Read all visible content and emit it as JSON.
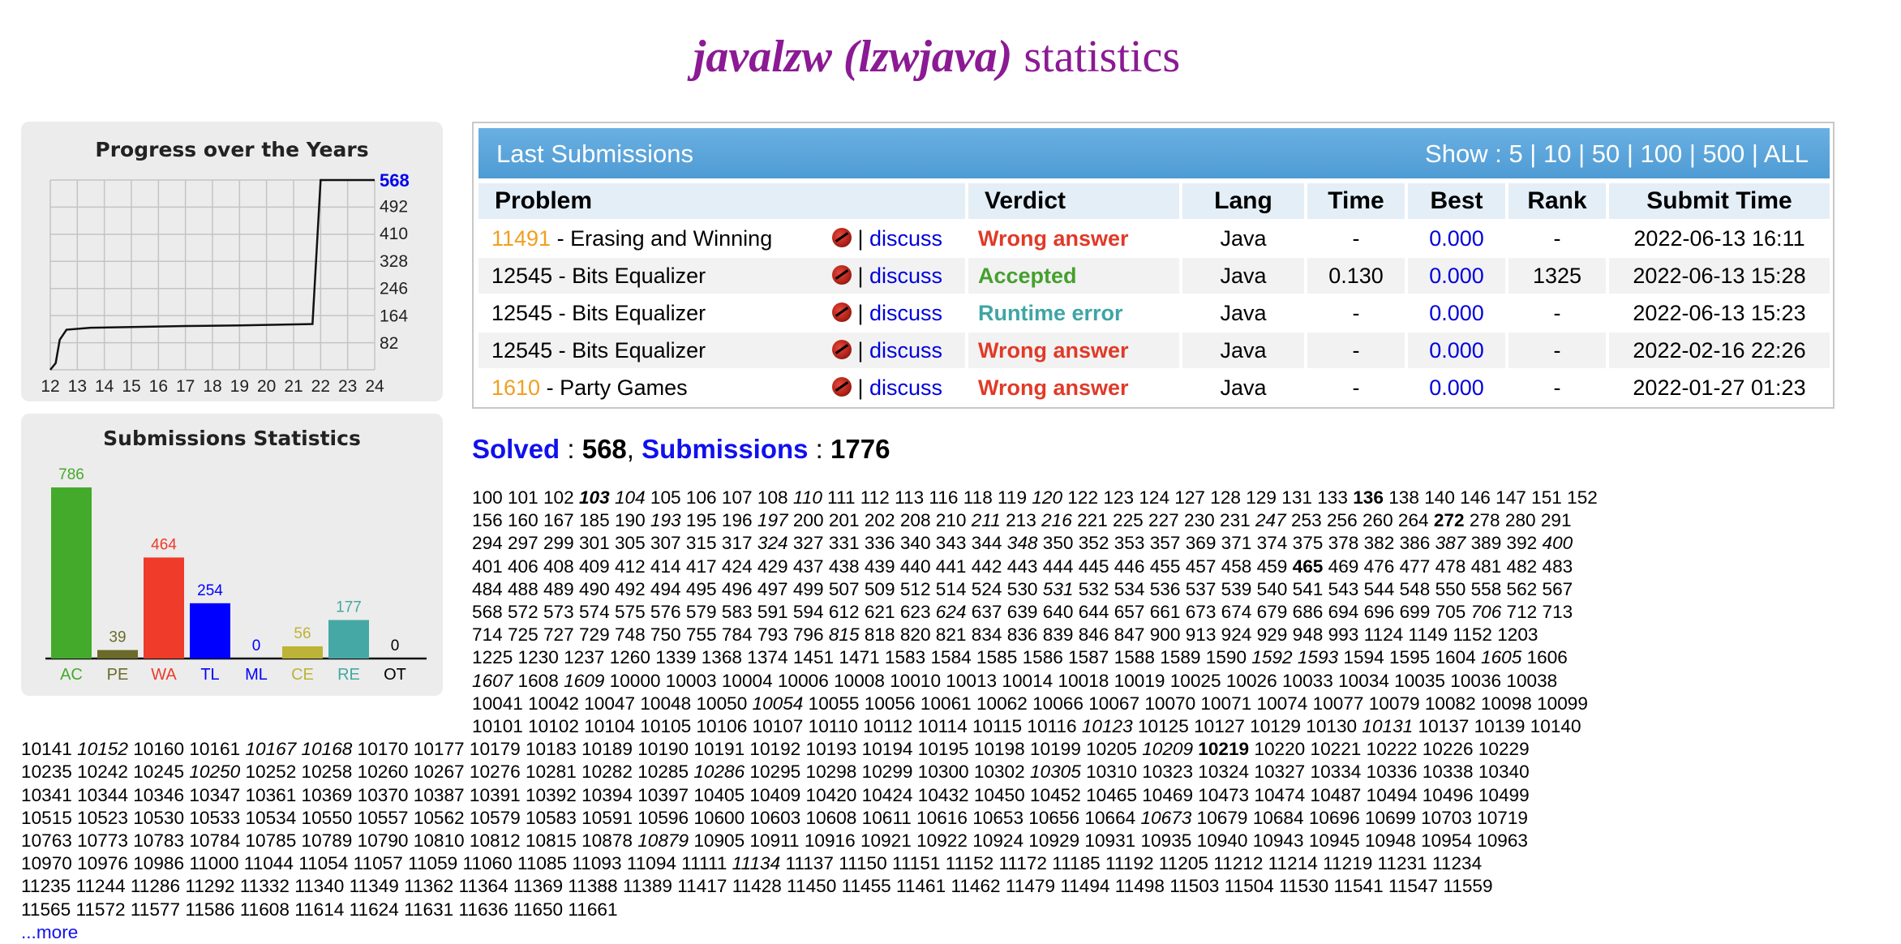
{
  "page": {
    "title_user": "javalzw (lzwjava)",
    "title_suffix": "statistics"
  },
  "progress_chart": {
    "title": "Progress over the Years",
    "x_ticks": [
      "12",
      "13",
      "14",
      "15",
      "16",
      "17",
      "18",
      "19",
      "20",
      "21",
      "22",
      "23",
      "24"
    ],
    "y_ticks": [
      "82",
      "164",
      "246",
      "328",
      "410",
      "492"
    ],
    "current_value_label": "568",
    "current_value_color": "#0000ee"
  },
  "submission_stats": {
    "title": "Submissions Statistics"
  },
  "chart_data": [
    {
      "type": "line",
      "title": "Progress over the Years",
      "x_ticks": [
        "12",
        "13",
        "14",
        "15",
        "16",
        "17",
        "18",
        "19",
        "20",
        "21",
        "22",
        "23",
        "24"
      ],
      "y_ticks": [
        82,
        164,
        246,
        328,
        410,
        492,
        568
      ],
      "ylim": [
        0,
        568
      ],
      "grid": true,
      "series": [
        {
          "points": [
            [
              12.0,
              0
            ],
            [
              12.2,
              20
            ],
            [
              12.35,
              90
            ],
            [
              12.6,
              120
            ],
            [
              13.5,
              126
            ],
            [
              15,
              128
            ],
            [
              17,
              131
            ],
            [
              19,
              133
            ],
            [
              21,
              136
            ],
            [
              21.7,
              137
            ],
            [
              22.0,
              568
            ],
            [
              24.0,
              568
            ]
          ]
        }
      ]
    },
    {
      "type": "bar",
      "title": "Submissions Statistics",
      "categories": [
        "AC",
        "PE",
        "WA",
        "TL",
        "ML",
        "CE",
        "RE",
        "OT"
      ],
      "values": [
        786,
        39,
        464,
        254,
        0,
        56,
        177,
        0
      ],
      "colors": [
        "#44aa2c",
        "#6b6a2a",
        "#ee3b2a",
        "#0000ff",
        "#0000ff",
        "#bdb336",
        "#45a8a4",
        "#000000"
      ],
      "label_colors": [
        "#44aa2c",
        "#6b6a2a",
        "#ee3b2a",
        "#0000ff",
        "#0000ff",
        "#bdb336",
        "#45a8a4",
        "#000000"
      ],
      "ylim": [
        0,
        786
      ]
    }
  ],
  "submissions": {
    "header_label": "Last Submissions",
    "show_label": "Show :",
    "show_options": [
      "5",
      "10",
      "50",
      "100",
      "500",
      "ALL"
    ],
    "columns": [
      "Problem",
      "Verdict",
      "Lang",
      "Time",
      "Best",
      "Rank",
      "Submit Time"
    ],
    "discuss_label": "discuss",
    "rows": [
      {
        "pid": "11491",
        "pid_color": "orange",
        "name": " - Erasing and Winning",
        "verdict": "Wrong answer",
        "vclass": "v-wa",
        "lang": "Java",
        "time": "-",
        "best": "0.000",
        "rank": "-",
        "submit": "2022-06-13 16:11"
      },
      {
        "pid": "12545",
        "pid_color": "black",
        "name": " - Bits Equalizer",
        "verdict": "Accepted",
        "vclass": "v-ac",
        "lang": "Java",
        "time": "0.130",
        "best": "0.000",
        "rank": "1325",
        "submit": "2022-06-13 15:28"
      },
      {
        "pid": "12545",
        "pid_color": "black",
        "name": " - Bits Equalizer",
        "verdict": "Runtime error",
        "vclass": "v-re",
        "lang": "Java",
        "time": "-",
        "best": "0.000",
        "rank": "-",
        "submit": "2022-06-13 15:23"
      },
      {
        "pid": "12545",
        "pid_color": "black",
        "name": " - Bits Equalizer",
        "verdict": "Wrong answer",
        "vclass": "v-wa",
        "lang": "Java",
        "time": "-",
        "best": "0.000",
        "rank": "-",
        "submit": "2022-02-16 22:26"
      },
      {
        "pid": "1610",
        "pid_color": "orange",
        "name": " - Party Games",
        "verdict": "Wrong answer",
        "vclass": "v-wa",
        "lang": "Java",
        "time": "-",
        "best": "0.000",
        "rank": "-",
        "submit": "2022-01-27 01:23"
      }
    ]
  },
  "summary": {
    "solved_label": "Solved",
    "solved_value": "568",
    "submissions_label": "Submissions",
    "submissions_value": "1776"
  },
  "solved_problems": [
    "100",
    "101",
    "102",
    "103|bi",
    "104|i",
    "105",
    "106",
    "107",
    "108",
    "110|i",
    "111",
    "112",
    "113",
    "116",
    "118",
    "119",
    "120|i",
    "122",
    "123",
    "124",
    "127",
    "128",
    "129",
    "131",
    "133",
    "136|b",
    "138",
    "140",
    "146",
    "147",
    "151",
    "152",
    "156",
    "160",
    "167",
    "185",
    "190",
    "193|i",
    "195",
    "196",
    "197|i",
    "200",
    "201",
    "202",
    "208",
    "210",
    "211|i",
    "213",
    "216|i",
    "221",
    "225",
    "227",
    "230",
    "231",
    "247|i",
    "253",
    "256",
    "260",
    "264",
    "272|b",
    "278",
    "280",
    "291",
    "294",
    "297",
    "299",
    "301",
    "305",
    "307",
    "315",
    "317",
    "324|i",
    "327",
    "331",
    "336",
    "340",
    "343",
    "344",
    "348|i",
    "350",
    "352",
    "353",
    "357",
    "369",
    "371",
    "374",
    "375",
    "378",
    "382",
    "386",
    "387|i",
    "389",
    "392",
    "400|i",
    "401",
    "406",
    "408",
    "409",
    "412",
    "414",
    "417",
    "424",
    "429",
    "437",
    "438",
    "439",
    "440",
    "441",
    "442",
    "443",
    "444",
    "445",
    "446",
    "455",
    "457",
    "458",
    "459",
    "465|b",
    "469",
    "476",
    "477",
    "478",
    "481",
    "482",
    "483",
    "484",
    "488",
    "489",
    "490",
    "492",
    "494",
    "495",
    "496",
    "497",
    "499",
    "507",
    "509",
    "512",
    "514",
    "524",
    "530",
    "531|i",
    "532",
    "534",
    "536",
    "537",
    "539",
    "540",
    "541",
    "543",
    "544",
    "548",
    "550",
    "558",
    "562",
    "567",
    "568",
    "572",
    "573",
    "574",
    "575",
    "576",
    "579",
    "583",
    "591",
    "594",
    "612",
    "621",
    "623",
    "624|i",
    "637",
    "639",
    "640",
    "644",
    "657",
    "661",
    "673",
    "674",
    "679",
    "686",
    "694",
    "696",
    "699",
    "705",
    "706|i",
    "712",
    "713",
    "714",
    "725",
    "727",
    "729",
    "748",
    "750",
    "755",
    "784",
    "793",
    "796",
    "815|i",
    "818",
    "820",
    "821",
    "834",
    "836",
    "839",
    "846",
    "847",
    "900",
    "913",
    "924",
    "929",
    "948",
    "993",
    "1124",
    "1149",
    "1152",
    "1203",
    "1225",
    "1230",
    "1237",
    "1260",
    "1339",
    "1368",
    "1374",
    "1451",
    "1471",
    "1583",
    "1584",
    "1585",
    "1586",
    "1587",
    "1588",
    "1589",
    "1590",
    "1592|i",
    "1593|i",
    "1594",
    "1595",
    "1604",
    "1605|i",
    "1606",
    "1607|i",
    "1608",
    "1609|i",
    "10000",
    "10003",
    "10004",
    "10006",
    "10008",
    "10010",
    "10013",
    "10014",
    "10018",
    "10019",
    "10025",
    "10026",
    "10033",
    "10034",
    "10035",
    "10036",
    "10038",
    "10041",
    "10042",
    "10047",
    "10048",
    "10050",
    "10054|i",
    "10055",
    "10056",
    "10061",
    "10062",
    "10066",
    "10067",
    "10070",
    "10071",
    "10074",
    "10077",
    "10079",
    "10082",
    "10098",
    "10099",
    "10101",
    "10102",
    "10104",
    "10105",
    "10106",
    "10107",
    "10110",
    "10112",
    "10114",
    "10115",
    "10116",
    "10123|i",
    "10125",
    "10127",
    "10129",
    "10130",
    "10131|i",
    "10137",
    "10139",
    "10140",
    "10141",
    "10152|i",
    "10160",
    "10161",
    "10167|i",
    "10168|i",
    "10170",
    "10177",
    "10179",
    "10183",
    "10189",
    "10190",
    "10191",
    "10192",
    "10193",
    "10194",
    "10195",
    "10198",
    "10199",
    "10205",
    "10209|i",
    "10219|b",
    "10220",
    "10221",
    "10222",
    "10226",
    "10229",
    "10235",
    "10242",
    "10245",
    "10250|i",
    "10252",
    "10258",
    "10260",
    "10267",
    "10276",
    "10281",
    "10282",
    "10285",
    "10286|i",
    "10295",
    "10298",
    "10299",
    "10300",
    "10302",
    "10305|i",
    "10310",
    "10323",
    "10324",
    "10327",
    "10334",
    "10336",
    "10338",
    "10340",
    "10341",
    "10344",
    "10346",
    "10347",
    "10361",
    "10369",
    "10370",
    "10387",
    "10391",
    "10392",
    "10394",
    "10397",
    "10405",
    "10409",
    "10420",
    "10424",
    "10432",
    "10450",
    "10452",
    "10465",
    "10469",
    "10473",
    "10474",
    "10487",
    "10494",
    "10496",
    "10499",
    "10515",
    "10523",
    "10530",
    "10533",
    "10534",
    "10550",
    "10557",
    "10562",
    "10579",
    "10583",
    "10591",
    "10596",
    "10600",
    "10603",
    "10608",
    "10611",
    "10616",
    "10653",
    "10656",
    "10664",
    "10673|i",
    "10679",
    "10684",
    "10696",
    "10699",
    "10703",
    "10719",
    "10763",
    "10773",
    "10783",
    "10784",
    "10785",
    "10789",
    "10790",
    "10810",
    "10812",
    "10815",
    "10878",
    "10879|i",
    "10905",
    "10911",
    "10916",
    "10921",
    "10922",
    "10924",
    "10929",
    "10931",
    "10935",
    "10940",
    "10943",
    "10945",
    "10948",
    "10954",
    "10963",
    "10970",
    "10976",
    "10986",
    "11000",
    "11044",
    "11054",
    "11057",
    "11059",
    "11060",
    "11085",
    "11093",
    "11094",
    "11111",
    "11134|i",
    "11137",
    "11150",
    "11151",
    "11152",
    "11172",
    "11185",
    "11192",
    "11205",
    "11212",
    "11214",
    "11219",
    "11231",
    "11234",
    "11235",
    "11244",
    "11286",
    "11292",
    "11332",
    "11340",
    "11349",
    "11362",
    "11364",
    "11369",
    "11388",
    "11389",
    "11417",
    "11428",
    "11450",
    "11455",
    "11461",
    "11462",
    "11479",
    "11494",
    "11498",
    "11503",
    "11504",
    "11530",
    "11541",
    "11547",
    "11559",
    "11565",
    "11572",
    "11577",
    "11586",
    "11608",
    "11614",
    "11624",
    "11631",
    "11636",
    "11650",
    "11661"
  ],
  "more_label": "...more"
}
